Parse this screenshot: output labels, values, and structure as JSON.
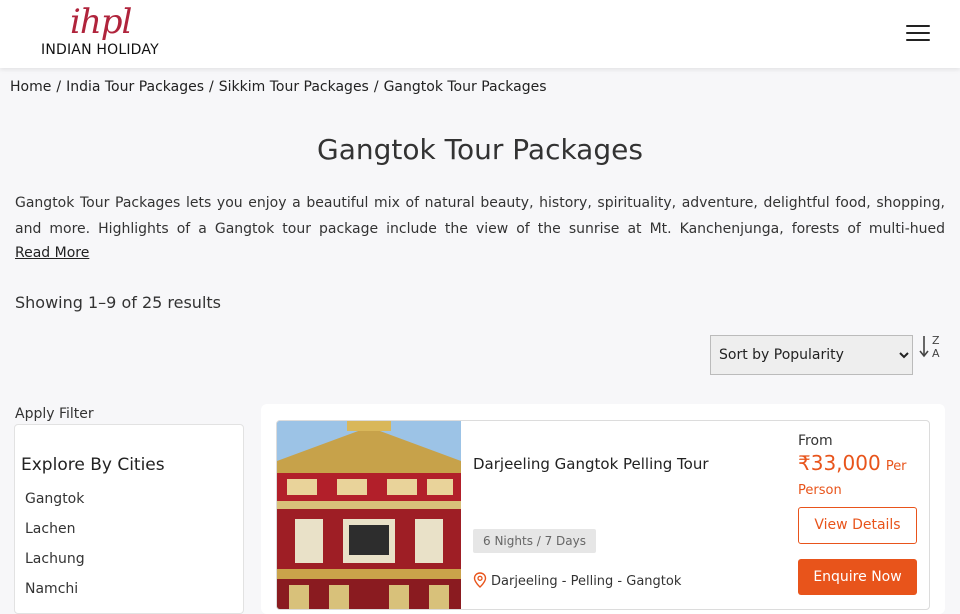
{
  "brand": {
    "logo_mark": "ihpl",
    "name": "INDIAN HOLIDAY"
  },
  "breadcrumb": [
    "Home",
    "India Tour Packages",
    "Sikkim Tour Packages",
    "Gangtok Tour Packages"
  ],
  "breadcrumb_separator": "/",
  "page": {
    "title": "Gangtok Tour Packages",
    "intro": "Gangtok Tour Packages lets you enjoy a beautiful mix of natural beauty, history, spirituality, adventure, delightful food, shopping, and more. Highlights of a Gangtok tour package include the view of the sunrise at Mt. Kanchenjunga, forests of multi-hued",
    "read_more": "Read More",
    "results_count": "Showing 1–9 of 25 results"
  },
  "sort": {
    "selected": "Sort by Popularity",
    "options": [
      "Sort by Popularity"
    ],
    "toggle_top": "Z",
    "toggle_bottom": "A"
  },
  "filter": {
    "label": "Apply Filter",
    "title": "Explore By Cities",
    "cities": [
      "Gangtok",
      "Lachen",
      "Lachung",
      "Namchi"
    ]
  },
  "package": {
    "title": "Darjeeling Gangtok Pelling Tour",
    "duration": "6 Nights / 7 Days",
    "route": "Darjeeling - Pelling - Gangtok",
    "price_from": "From",
    "price_currency": "₹",
    "price_amount": "33,000",
    "price_unit": "Per Person",
    "view_details": "View Details",
    "enquire": "Enquire Now"
  },
  "icons": {
    "menu": "hamburger-menu-icon",
    "sort": "sort-alpha-icon",
    "location": "location-pin-icon"
  },
  "colors": {
    "accent": "#e8541b",
    "brand": "#b0243c",
    "background": "#f7f7f9"
  }
}
